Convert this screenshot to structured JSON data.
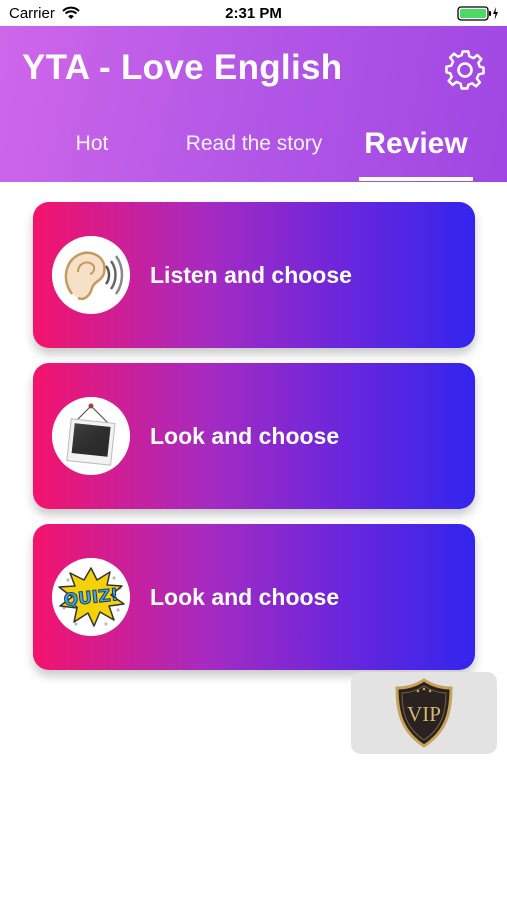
{
  "status_bar": {
    "carrier": "Carrier",
    "time": "2:31 PM",
    "icons": [
      "wifi-icon",
      "battery-icon"
    ]
  },
  "header": {
    "title": "YTA - Love English",
    "settings_icon": "gear-icon",
    "gradient": [
      "#cf66ea",
      "#a047e3"
    ]
  },
  "tabs": [
    {
      "label": "Hot",
      "active": false
    },
    {
      "label": "Read the story",
      "active": false
    },
    {
      "label": "Review",
      "active": true
    }
  ],
  "cards": [
    {
      "label": "Listen and choose",
      "icon": "ear-sound-icon"
    },
    {
      "label": "Look and choose",
      "icon": "picture-frame-icon"
    },
    {
      "label": "Look and choose",
      "icon": "quiz-icon"
    }
  ],
  "card_gradient": [
    "#f4136c",
    "#3325ee"
  ],
  "vip": {
    "badge_text": "VIP",
    "icon": "vip-shield-icon",
    "colors": {
      "shield": "#2a2220",
      "gold": "#c9a25a"
    }
  }
}
